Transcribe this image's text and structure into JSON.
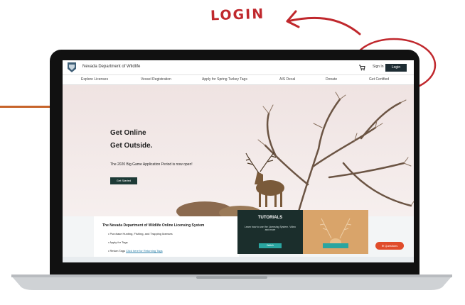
{
  "annotation": {
    "label": "LOGIN"
  },
  "header": {
    "agency": "Nevada Department of Wildlife",
    "sign_in": "Sign In",
    "login": "Login"
  },
  "nav": {
    "items": [
      "Explore Licenses",
      "Vessel Registration",
      "Apply for Spring Turkey Tags",
      "AIS Decal",
      "Donate",
      "Get Certified"
    ]
  },
  "hero": {
    "line1": "Get Online",
    "line2": "Get Outside.",
    "subtitle": "The 2020 Big Game Application Period is now open!",
    "button": "Get Started"
  },
  "info": {
    "title": "The Nevada Department of Wildlife Online Licensing System",
    "bullets": [
      "Purchase Hunting, Fishing, and Trapping licenses",
      "Apply for Tags",
      "Return Tags"
    ],
    "link": "Click here for Returning Tags"
  },
  "cards": [
    {
      "title": "TUTORIALS",
      "text": "Learn how to use the Licensing System. Video and more",
      "button": "Watch"
    },
    {
      "title": "",
      "text": "",
      "button": ""
    }
  ],
  "help_button": "Questions",
  "colors": {
    "accent": "#c0282d",
    "nav_dark": "#1d2c33",
    "teal": "#2aa5a0",
    "help": "#e04c2b"
  }
}
